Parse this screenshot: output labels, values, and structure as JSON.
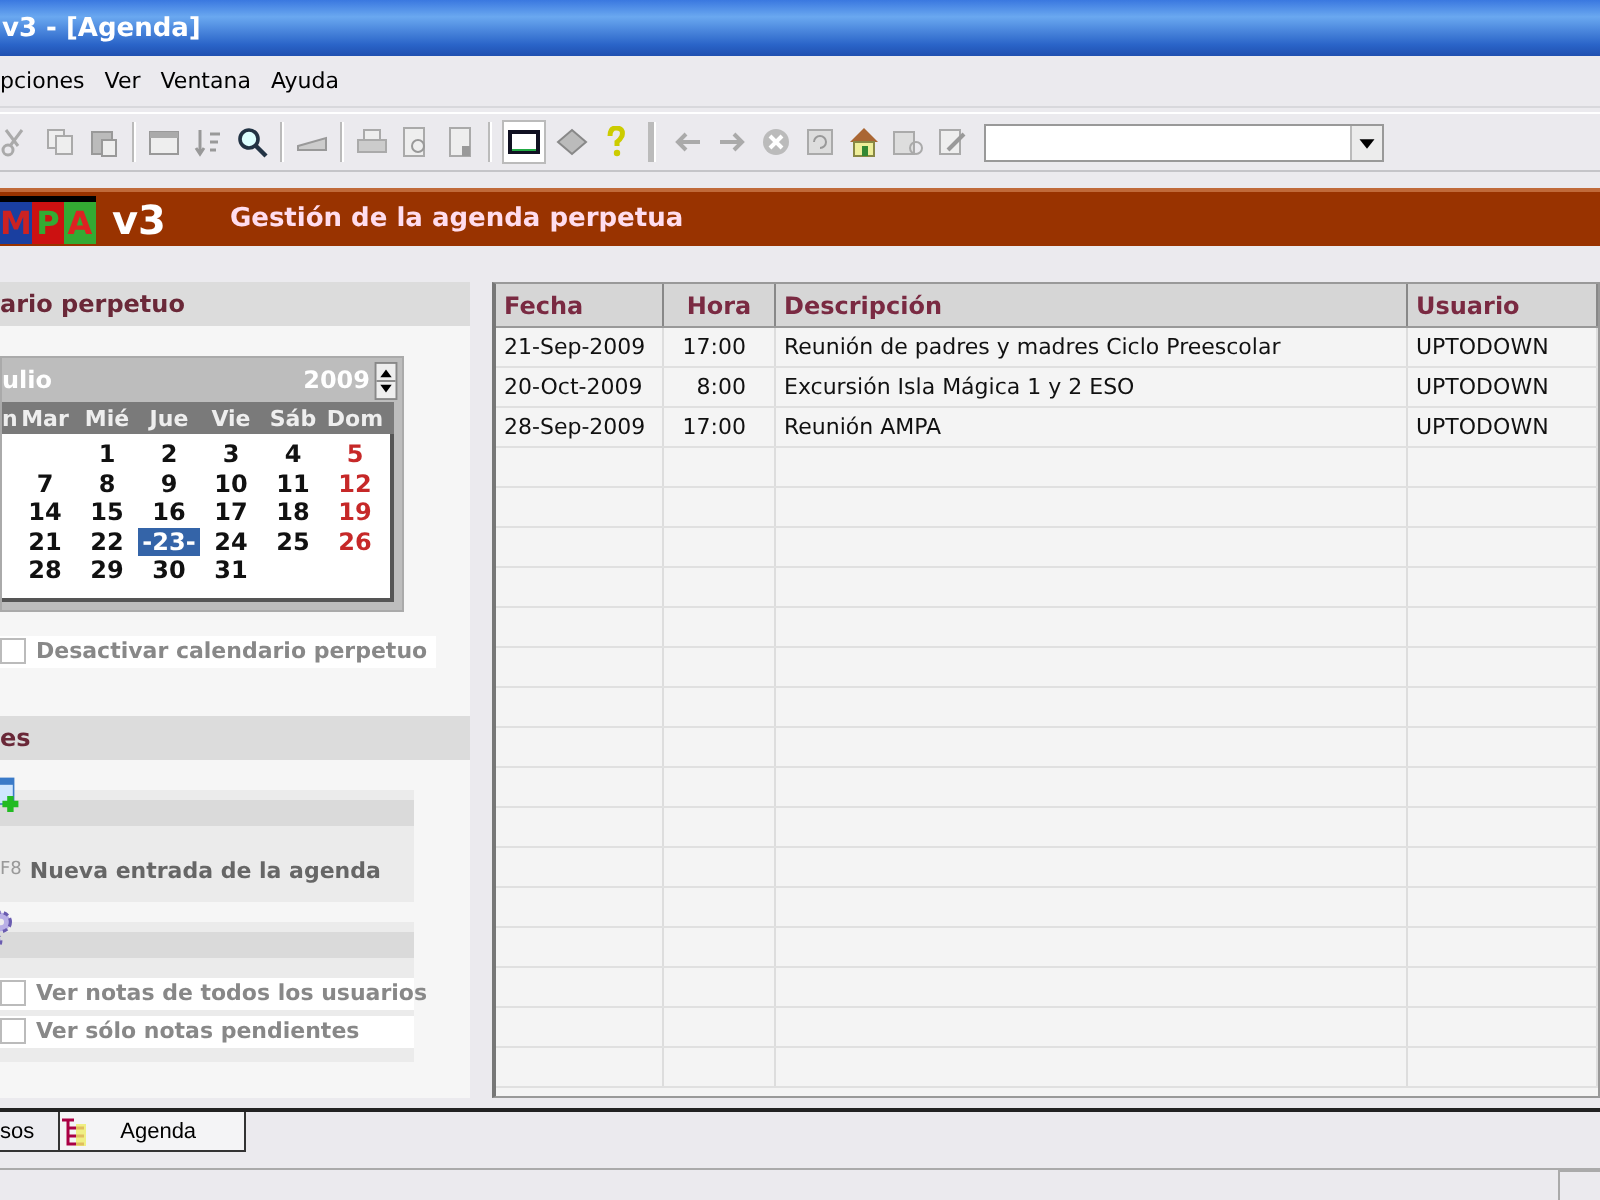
{
  "window": {
    "title": "v3 - [Agenda]"
  },
  "menu": [
    {
      "label": "pciones"
    },
    {
      "label": "Ver"
    },
    {
      "label": "Ventana"
    },
    {
      "label": "Ayuda"
    }
  ],
  "banner": {
    "logo_letters": [
      "M",
      "P",
      "A"
    ],
    "version": "v3",
    "title": "Gestión de la agenda perpetua"
  },
  "calendar_panel": {
    "title": "ario perpetuo",
    "month": "ulio",
    "year": "2009",
    "weekdays": [
      "n",
      "Mar",
      "Mié",
      "Jue",
      "Vie",
      "Sáb",
      "Dom"
    ],
    "weeks": [
      [
        {
          "kind": "empty"
        },
        {
          "kind": "day",
          "day": "1",
          "selected": false
        },
        {
          "kind": "day",
          "day": "2",
          "selected": false
        },
        {
          "kind": "day",
          "day": "3",
          "selected": false
        },
        {
          "kind": "day",
          "day": "4",
          "selected": false
        },
        {
          "kind": "day",
          "day": "5",
          "selected": false
        }
      ],
      [
        {
          "kind": "day",
          "day": "7",
          "selected": false
        },
        {
          "kind": "day",
          "day": "8",
          "selected": false
        },
        {
          "kind": "day",
          "day": "9",
          "selected": false
        },
        {
          "kind": "day",
          "day": "10",
          "selected": false
        },
        {
          "kind": "day",
          "day": "11",
          "selected": false
        },
        {
          "kind": "day",
          "day": "12",
          "selected": false
        }
      ],
      [
        {
          "kind": "day",
          "day": "14",
          "selected": false
        },
        {
          "kind": "day",
          "day": "15",
          "selected": false
        },
        {
          "kind": "day",
          "day": "16",
          "selected": false
        },
        {
          "kind": "day",
          "day": "17",
          "selected": false
        },
        {
          "kind": "day",
          "day": "18",
          "selected": false
        },
        {
          "kind": "day",
          "day": "19",
          "selected": false
        }
      ],
      [
        {
          "kind": "day",
          "day": "21",
          "selected": false
        },
        {
          "kind": "day",
          "day": "22",
          "selected": false
        },
        {
          "kind": "day",
          "day": "-23-",
          "selected": true
        },
        {
          "kind": "day",
          "day": "24",
          "selected": false
        },
        {
          "kind": "day",
          "day": "25",
          "selected": false
        },
        {
          "kind": "day",
          "day": "26",
          "selected": false
        }
      ],
      [
        {
          "kind": "day",
          "day": "28",
          "selected": false
        },
        {
          "kind": "day",
          "day": "29",
          "selected": false
        },
        {
          "kind": "day",
          "day": "30",
          "selected": false
        },
        {
          "kind": "day",
          "day": "31",
          "selected": false
        },
        {
          "kind": "empty"
        },
        {
          "kind": "empty"
        }
      ]
    ],
    "disable_option": {
      "label": "Desactivar calendario perpetuo",
      "checked": false
    }
  },
  "tasks_panel": {
    "title": "es",
    "new_entry": {
      "shortcut": "F8",
      "label": "Nueva entrada de la agenda"
    },
    "filters": [
      {
        "label": "Ver notas de todos los usuarios",
        "checked": false
      },
      {
        "label": "Ver sólo notas pendientes",
        "checked": false
      }
    ]
  },
  "table": {
    "columns": [
      "Fecha",
      "Hora",
      "Descripción",
      "Usuario"
    ],
    "rows": [
      [
        "21-Sep-2009",
        "17:00",
        "Reunión de padres y madres Ciclo Preescolar",
        "UPTODOWN"
      ],
      [
        "20-Oct-2009",
        "8:00",
        "Excursión Isla Mágica 1 y 2 ESO",
        "UPTODOWN"
      ],
      [
        "28-Sep-2009",
        "17:00",
        "Reunión AMPA",
        "UPTODOWN"
      ]
    ]
  },
  "bottom_tabs": [
    {
      "label": "sos",
      "selected": false
    },
    {
      "label": "Agenda",
      "selected": true
    }
  ]
}
